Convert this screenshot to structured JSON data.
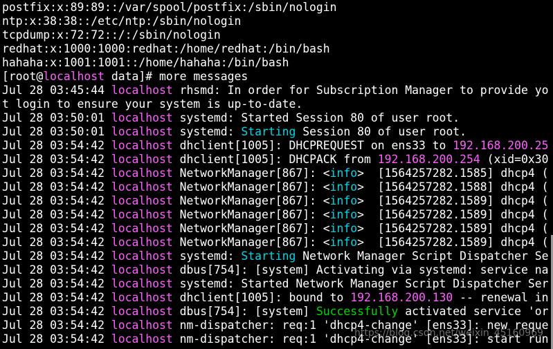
{
  "terminal": {
    "lines": [
      [
        {
          "t": "postfix:x:89:89::/var/spool/postfix:/sbin/nologin",
          "c": ""
        }
      ],
      [
        {
          "t": "ntp:x:38:38::/etc/ntp:/sbin/nologin",
          "c": ""
        }
      ],
      [
        {
          "t": "tcpdump:x:72:72::/:/sbin/nologin",
          "c": ""
        }
      ],
      [
        {
          "t": "redhat:x:1000:1000:redhat:/home/redhat:/bin/bash",
          "c": ""
        }
      ],
      [
        {
          "t": "hahaha:x:1001:1001::/home/hahaha:/bin/bash",
          "c": ""
        }
      ],
      [
        {
          "t": "[root@",
          "c": ""
        },
        {
          "t": "localhost",
          "c": "host"
        },
        {
          "t": " data]# more messages",
          "c": ""
        }
      ],
      [
        {
          "t": "Jul 28 03:45:44 ",
          "c": ""
        },
        {
          "t": "localhost",
          "c": "host"
        },
        {
          "t": " rhsmd: In order for Subscription Manager to provide yo",
          "c": ""
        }
      ],
      [
        {
          "t": "t login to ensure your system is up-to-date.",
          "c": ""
        }
      ],
      [
        {
          "t": "Jul 28 03:50:01 ",
          "c": ""
        },
        {
          "t": "localhost",
          "c": "host"
        },
        {
          "t": " systemd: Started Session 80 of user root.",
          "c": ""
        }
      ],
      [
        {
          "t": "Jul 28 03:50:01 ",
          "c": ""
        },
        {
          "t": "localhost",
          "c": "host"
        },
        {
          "t": " systemd: ",
          "c": ""
        },
        {
          "t": "Starting",
          "c": "cyan"
        },
        {
          "t": " Session 80 of user root.",
          "c": ""
        }
      ],
      [
        {
          "t": "Jul 28 03:54:42 ",
          "c": ""
        },
        {
          "t": "localhost",
          "c": "host"
        },
        {
          "t": " dhclient[1005]: DHCPREQUEST on ens33 to ",
          "c": ""
        },
        {
          "t": "192.168.200.25",
          "c": "host"
        }
      ],
      [
        {
          "t": "Jul 28 03:54:42 ",
          "c": ""
        },
        {
          "t": "localhost",
          "c": "host"
        },
        {
          "t": " dhclient[1005]: DHCPACK from ",
          "c": ""
        },
        {
          "t": "192.168.200.254",
          "c": "host"
        },
        {
          "t": " (xid=0x30",
          "c": ""
        }
      ],
      [
        {
          "t": "Jul 28 03:54:42 ",
          "c": ""
        },
        {
          "t": "localhost",
          "c": "host"
        },
        {
          "t": " NetworkManager[867]: <",
          "c": ""
        },
        {
          "t": "info",
          "c": "cyan"
        },
        {
          "t": ">  [1564257282.1585] dhcp4 (",
          "c": ""
        }
      ],
      [
        {
          "t": "Jul 28 03:54:42 ",
          "c": ""
        },
        {
          "t": "localhost",
          "c": "host"
        },
        {
          "t": " NetworkManager[867]: <",
          "c": ""
        },
        {
          "t": "info",
          "c": "cyan"
        },
        {
          "t": ">  [1564257282.1588] dhcp4 (",
          "c": ""
        }
      ],
      [
        {
          "t": "Jul 28 03:54:42 ",
          "c": ""
        },
        {
          "t": "localhost",
          "c": "host"
        },
        {
          "t": " NetworkManager[867]: <",
          "c": ""
        },
        {
          "t": "info",
          "c": "cyan"
        },
        {
          "t": ">  [1564257282.1589] dhcp4 (",
          "c": ""
        }
      ],
      [
        {
          "t": "Jul 28 03:54:42 ",
          "c": ""
        },
        {
          "t": "localhost",
          "c": "host"
        },
        {
          "t": " NetworkManager[867]: <",
          "c": ""
        },
        {
          "t": "info",
          "c": "cyan"
        },
        {
          "t": ">  [1564257282.1589] dhcp4 (",
          "c": ""
        }
      ],
      [
        {
          "t": "Jul 28 03:54:42 ",
          "c": ""
        },
        {
          "t": "localhost",
          "c": "host"
        },
        {
          "t": " NetworkManager[867]: <",
          "c": ""
        },
        {
          "t": "info",
          "c": "cyan"
        },
        {
          "t": ">  [1564257282.1589] dhcp4 (",
          "c": ""
        }
      ],
      [
        {
          "t": "Jul 28 03:54:42 ",
          "c": ""
        },
        {
          "t": "localhost",
          "c": "host"
        },
        {
          "t": " NetworkManager[867]: <",
          "c": ""
        },
        {
          "t": "info",
          "c": "cyan"
        },
        {
          "t": ">  [1564257282.1589] dhcp4 (",
          "c": ""
        }
      ],
      [
        {
          "t": "Jul 28 03:54:42 ",
          "c": ""
        },
        {
          "t": "localhost",
          "c": "host"
        },
        {
          "t": " systemd: ",
          "c": ""
        },
        {
          "t": "Starting",
          "c": "cyan"
        },
        {
          "t": " Network Manager Script Dispatcher Se",
          "c": ""
        }
      ],
      [
        {
          "t": "Jul 28 03:54:42 ",
          "c": ""
        },
        {
          "t": "localhost",
          "c": "host"
        },
        {
          "t": " dbus[754]: [system] Activating via systemd: service na",
          "c": ""
        }
      ],
      [
        {
          "t": "Jul 28 03:54:42 ",
          "c": ""
        },
        {
          "t": "localhost",
          "c": "host"
        },
        {
          "t": " systemd: Started Network Manager Script Dispatcher Ser",
          "c": ""
        }
      ],
      [
        {
          "t": "Jul 28 03:54:42 ",
          "c": ""
        },
        {
          "t": "localhost",
          "c": "host"
        },
        {
          "t": " dhclient[1005]: bound to ",
          "c": ""
        },
        {
          "t": "192.168.200.130",
          "c": "host"
        },
        {
          "t": " -- renewal in",
          "c": ""
        }
      ],
      [
        {
          "t": "Jul 28 03:54:42 ",
          "c": ""
        },
        {
          "t": "localhost",
          "c": "host"
        },
        {
          "t": " dbus[754]: [system] ",
          "c": ""
        },
        {
          "t": "Successfully",
          "c": "green"
        },
        {
          "t": " activated service 'or",
          "c": ""
        }
      ],
      [
        {
          "t": "Jul 28 03:54:42 ",
          "c": ""
        },
        {
          "t": "localhost",
          "c": "host"
        },
        {
          "t": " nm-dispatcher: req:1 'dhcp4-change' [ens33]: new reque",
          "c": ""
        }
      ],
      [
        {
          "t": "Jul 28 03:54:42 ",
          "c": ""
        },
        {
          "t": "localhost",
          "c": "host"
        },
        {
          "t": " nm-dispatcher: req:1 'dhcp4-change' [ens33]: start run",
          "c": ""
        }
      ]
    ]
  },
  "watermark": "https://blog.csdn.net/weixin_45160969",
  "colors": {
    "background": "#000000",
    "foreground": "#ffffff",
    "host": "#ff5fff",
    "cyan": "#00d7e6",
    "green": "#00d700"
  }
}
